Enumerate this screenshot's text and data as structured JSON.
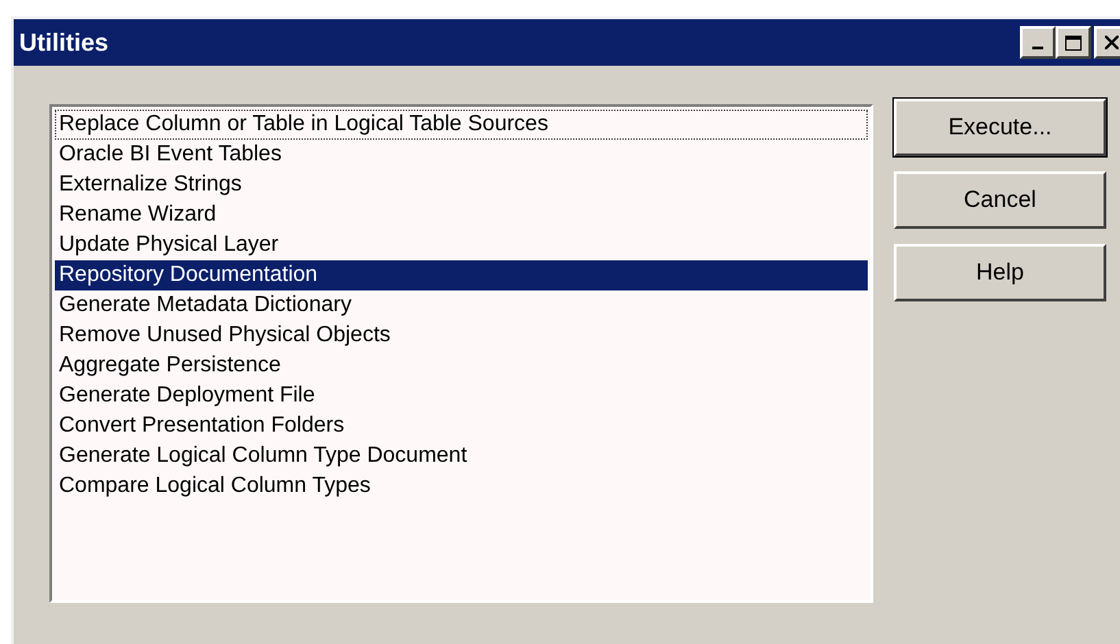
{
  "window": {
    "title": "Utilities"
  },
  "list": {
    "items": [
      {
        "label": "Replace Column or Table in Logical Table Sources",
        "selected": false,
        "focused": true
      },
      {
        "label": "Oracle BI Event Tables",
        "selected": false,
        "focused": false
      },
      {
        "label": "Externalize Strings",
        "selected": false,
        "focused": false
      },
      {
        "label": "Rename Wizard",
        "selected": false,
        "focused": false
      },
      {
        "label": "Update Physical Layer",
        "selected": false,
        "focused": false
      },
      {
        "label": "Repository Documentation",
        "selected": true,
        "focused": false
      },
      {
        "label": "Generate Metadata Dictionary",
        "selected": false,
        "focused": false
      },
      {
        "label": "Remove Unused Physical Objects",
        "selected": false,
        "focused": false
      },
      {
        "label": "Aggregate Persistence",
        "selected": false,
        "focused": false
      },
      {
        "label": "Generate Deployment File",
        "selected": false,
        "focused": false
      },
      {
        "label": "Convert Presentation Folders",
        "selected": false,
        "focused": false
      },
      {
        "label": "Generate Logical Column Type Document",
        "selected": false,
        "focused": false
      },
      {
        "label": "Compare Logical Column Types",
        "selected": false,
        "focused": false
      }
    ]
  },
  "buttons": [
    {
      "label": "Execute...",
      "default": true
    },
    {
      "label": "Cancel",
      "default": false
    },
    {
      "label": "Help",
      "default": false
    }
  ]
}
